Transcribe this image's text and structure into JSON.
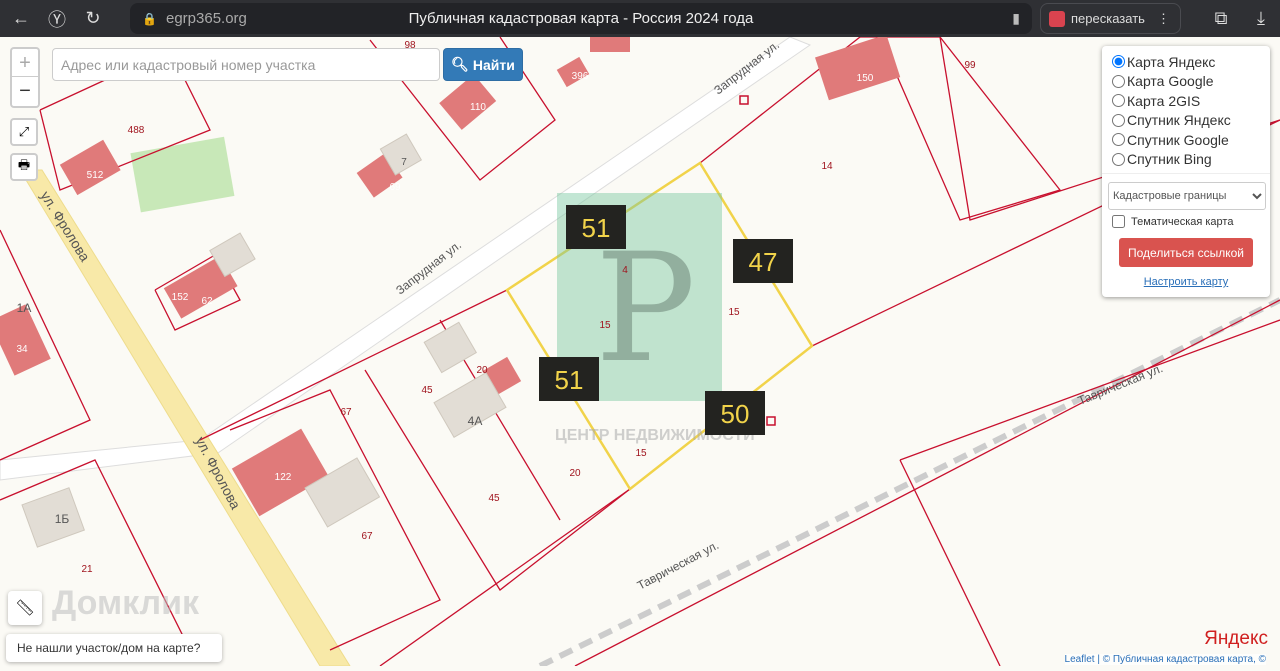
{
  "browser": {
    "host": "egrp365.org",
    "title": "Публичная кадастровая карта - Россия 2024 года",
    "retell": "пересказать"
  },
  "search": {
    "placeholder": "Адрес или кадастровый номер участка",
    "button": "Найти"
  },
  "zoom": {
    "in": "+",
    "out": "−"
  },
  "layers": {
    "options": [
      "Карта Яндекс",
      "Карта Google",
      "Карта 2GIS",
      "Спутник Яндекс",
      "Спутник Google",
      "Спутник Bing"
    ],
    "selected": "Карта Яндекс",
    "overlay": "Кадастровые границы",
    "thematic": "Тематическая карта",
    "share": "Поделиться ссылкой",
    "configure": "Настроить карту"
  },
  "not_found": "Не нашли участок/дом на карте?",
  "map": {
    "streets": {
      "frolova1": "ул. Фролова",
      "frolova2": "ул. Фролова",
      "zaprud1": "Запрудная ул.",
      "zaprud2": "Запрудная ул.",
      "tavr1": "Таврическая ул.",
      "tavr2": "Таврическая ул."
    },
    "houses": [
      "150",
      "396",
      "110",
      "69",
      "512",
      "152",
      "62",
      "122",
      "4А",
      "1Б",
      "1А",
      "34",
      "7"
    ],
    "parcels": [
      "98",
      "99",
      "488",
      "14",
      "4",
      "15",
      "15",
      "15",
      "45",
      "67",
      "45",
      "20",
      "20",
      "67",
      "21"
    ],
    "plot_labels": [
      "51",
      "47",
      "51",
      "50"
    ],
    "watermark": "ЦЕНТР НЕДВИЖИМОСТИ",
    "brand": "Домклик",
    "yandex": "Яндекс",
    "attribution": "Leaflet | © Публичная кадастровая карта, ©"
  },
  "colors": {
    "parcel": "#c8102e",
    "plot": "#f1d34a",
    "house": "#e07a7a",
    "share": "#d9534f",
    "find": "#337ab7"
  }
}
